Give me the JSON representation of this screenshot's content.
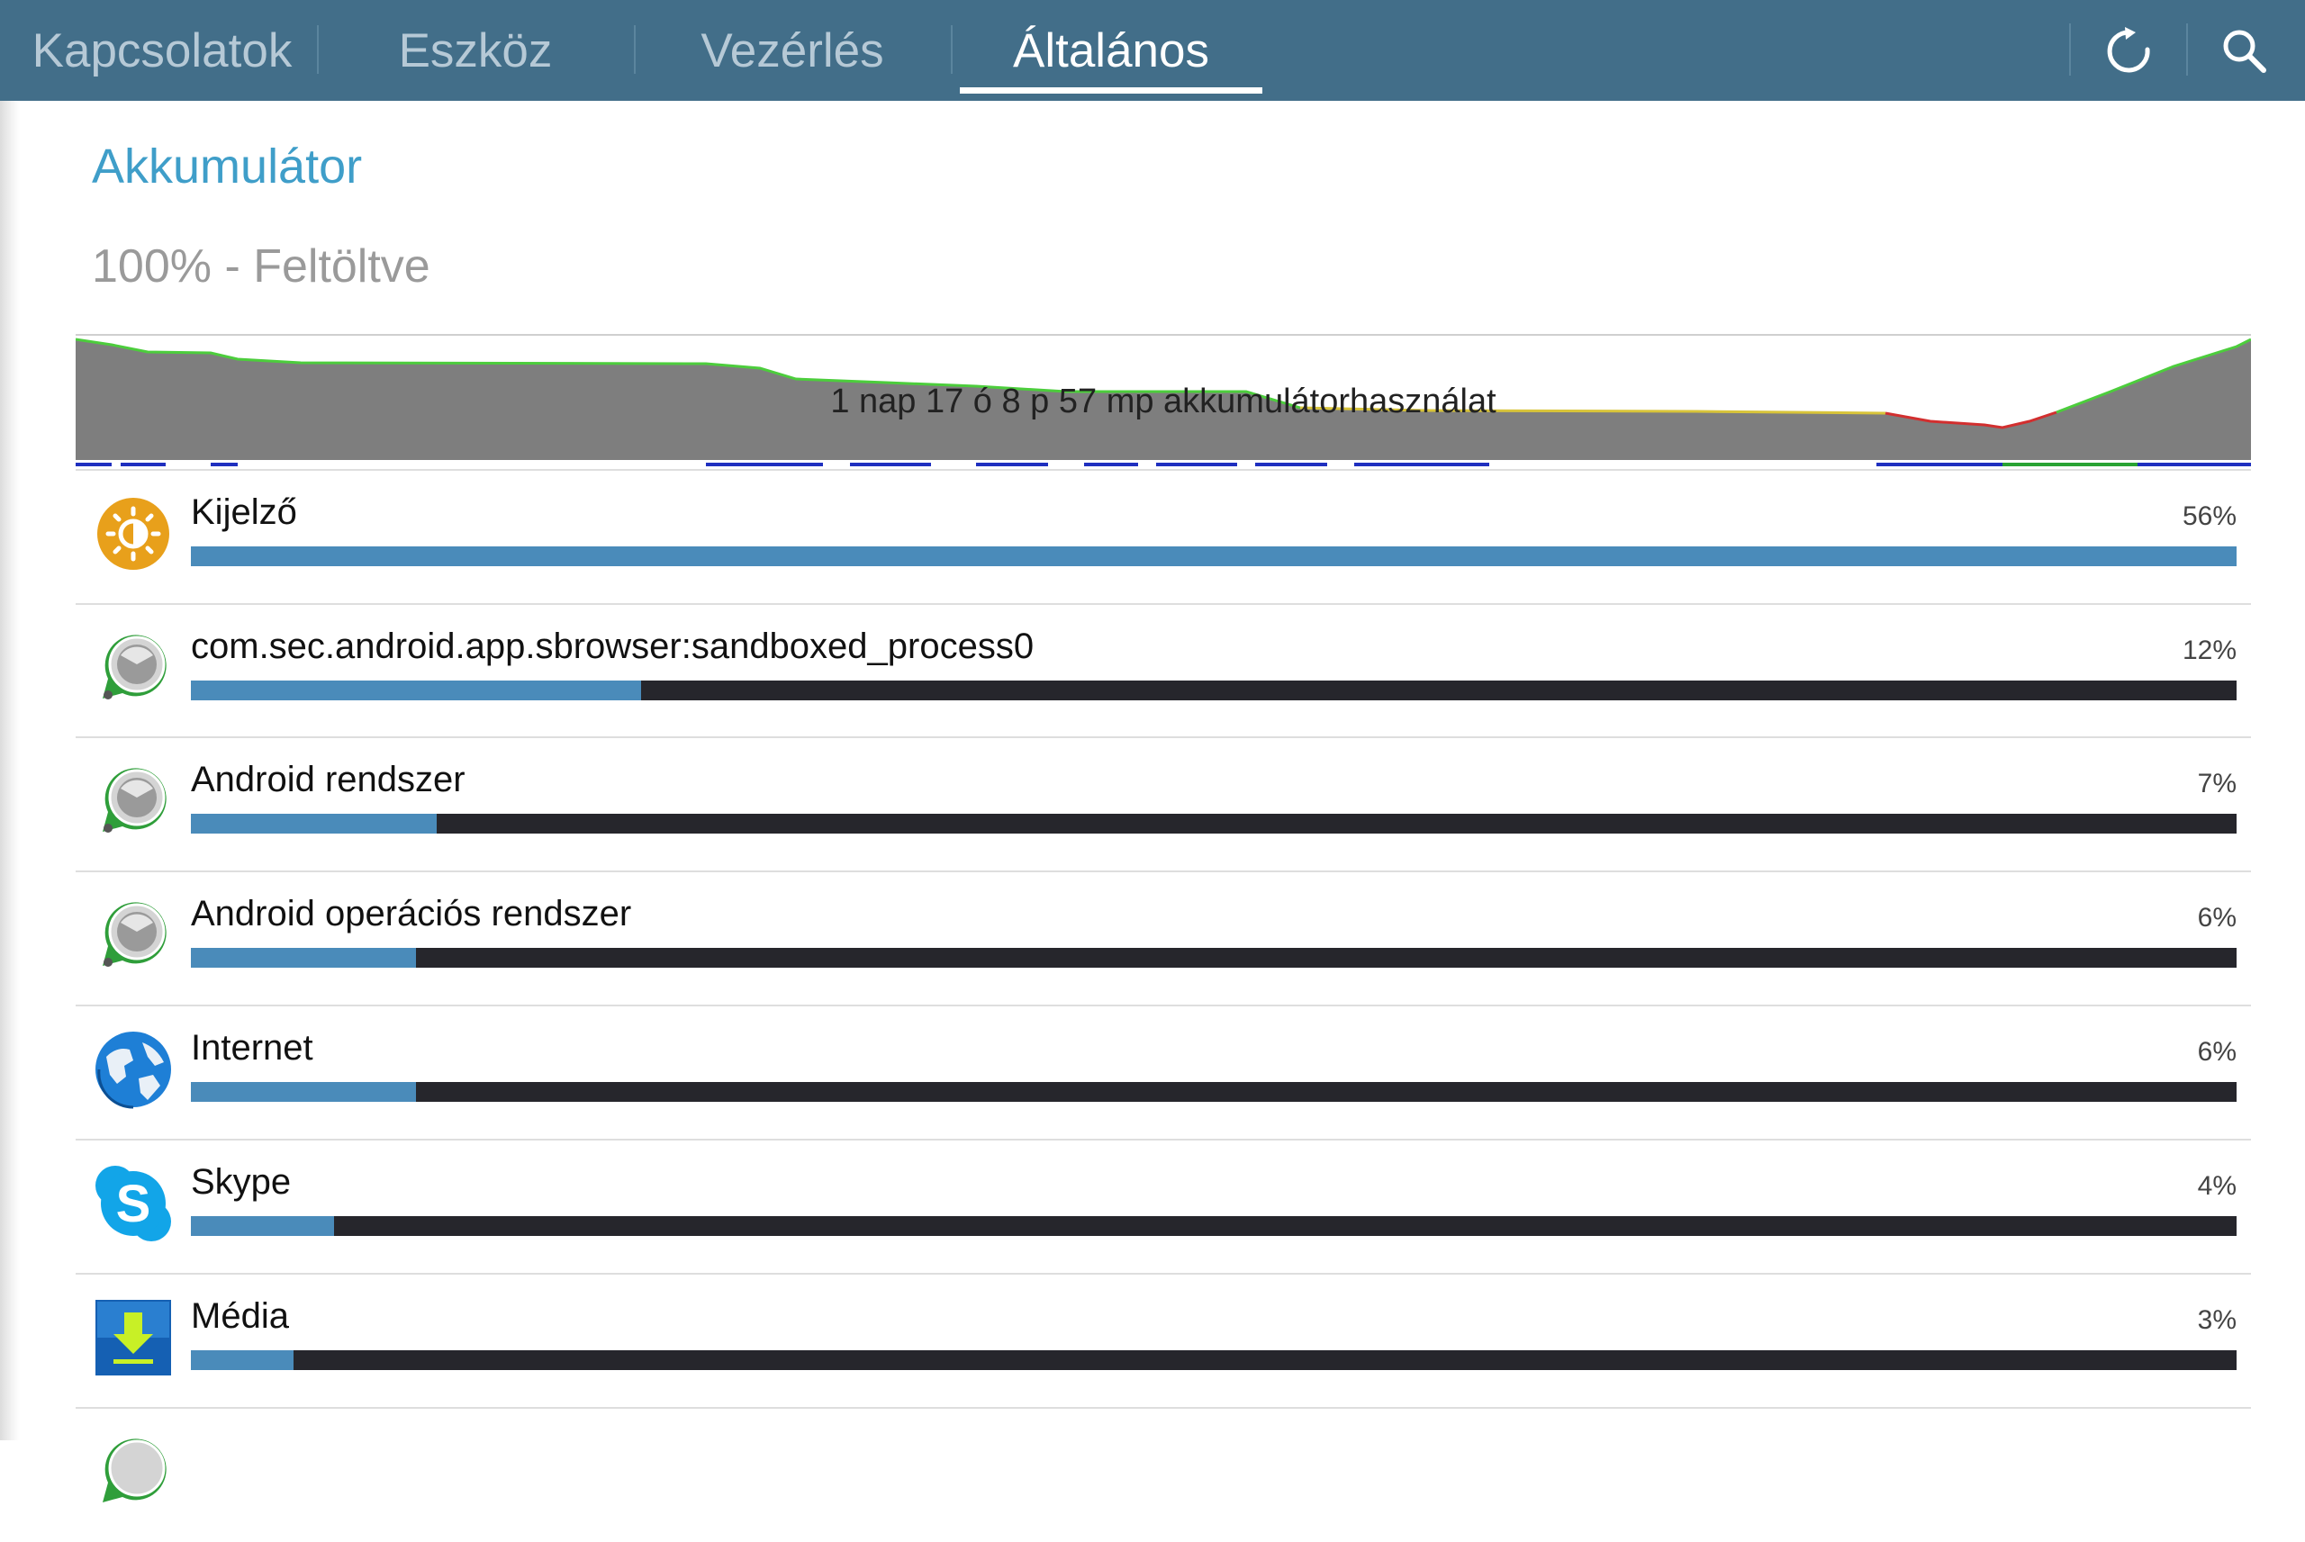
{
  "header": {
    "tabs": [
      {
        "label": "Kapcsolatok"
      },
      {
        "label": "Eszköz"
      },
      {
        "label": "Vezérlés"
      },
      {
        "label": "Általános"
      }
    ],
    "active_tab": "Általános",
    "actions": [
      {
        "icon": "refresh-icon"
      },
      {
        "icon": "search-icon"
      }
    ],
    "bar_color": "#426e89"
  },
  "battery": {
    "title": "Akkumulátor",
    "status": "100% - Feltöltve",
    "graph_label": "1 nap 17 ó 8 p 57 mp akkumulátorhasználat"
  },
  "usage": [
    {
      "name": "Kijelző",
      "percent_label": "56%",
      "bar_fraction": 1.0,
      "icon": "display-brightness-icon"
    },
    {
      "name": "com.sec.android.app.sbrowser:sandboxed_process0",
      "percent_label": "12%",
      "bar_fraction": 0.22,
      "icon": "android-system-icon"
    },
    {
      "name": "Android rendszer",
      "percent_label": "7%",
      "bar_fraction": 0.12,
      "icon": "android-system-icon"
    },
    {
      "name": "Android operációs rendszer",
      "percent_label": "6%",
      "bar_fraction": 0.11,
      "icon": "android-system-icon"
    },
    {
      "name": "Internet",
      "percent_label": "6%",
      "bar_fraction": 0.11,
      "icon": "globe-icon"
    },
    {
      "name": "Skype",
      "percent_label": "4%",
      "bar_fraction": 0.07,
      "icon": "skype-icon"
    },
    {
      "name": "Média",
      "percent_label": "3%",
      "bar_fraction": 0.05,
      "icon": "download-media-icon"
    }
  ],
  "colors": {
    "accent_blue": "#3f9ec9",
    "bar_fill": "#4a8bba",
    "bar_track": "#26262c"
  }
}
